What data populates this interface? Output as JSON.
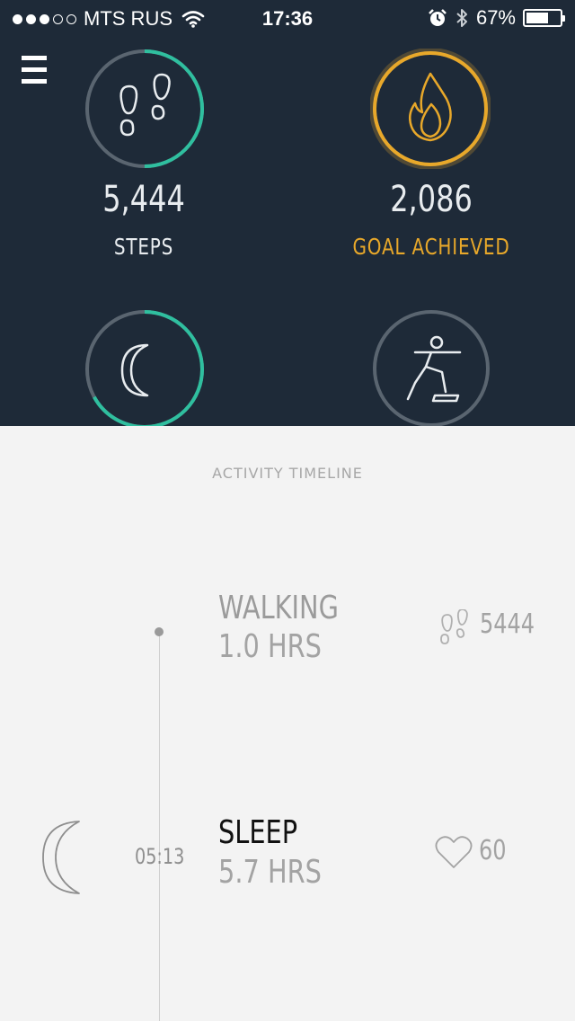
{
  "status_bar": {
    "carrier": "MTS RUS",
    "signal_bars_filled": 3,
    "signal_bars_total": 5,
    "time": "17:36",
    "battery_percent": "67%",
    "battery_level": 0.67
  },
  "dashboard": {
    "steps": {
      "value": "5,444",
      "label": "STEPS",
      "ring_progress": 0.5,
      "color": "#2fbf9f"
    },
    "calories": {
      "value": "2,086",
      "label": "GOAL ACHIEVED",
      "ring_progress": 1.0,
      "color": "#e8a82a"
    },
    "sleep": {
      "ring_progress": 0.67,
      "color": "#2fbf9f"
    },
    "workout": {
      "ring_progress": 0.0
    }
  },
  "timeline": {
    "title": "ACTIVITY TIMELINE",
    "entries": [
      {
        "name": "WALKING",
        "duration": "1.0 HRS",
        "stat_icon": "footsteps-icon",
        "stat_value": "5444"
      },
      {
        "name": "SLEEP",
        "duration": "5.7 HRS",
        "time": "05:13",
        "icon": "moon-icon",
        "stat_icon": "heart-icon",
        "stat_value": "60"
      }
    ]
  },
  "colors": {
    "header_bg": "#1e2a38",
    "teal": "#2fbf9f",
    "gold": "#e8a82a",
    "ring_track": "#5a6570",
    "page_bg": "#f3f3f3"
  }
}
